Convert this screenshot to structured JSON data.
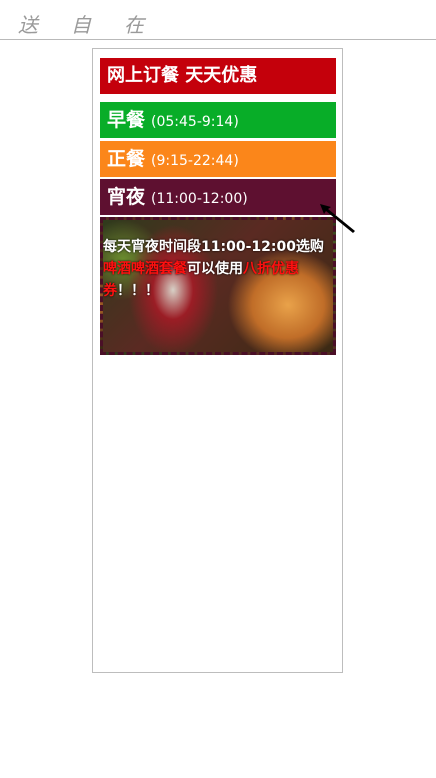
{
  "topbar": {
    "text": "送自在"
  },
  "header": {
    "title": "网上订餐 天天优惠"
  },
  "meals": [
    {
      "name": "早餐",
      "time": "(05:45-9:14)"
    },
    {
      "name": "正餐",
      "time": "(9:15-22:44)"
    },
    {
      "name": "宵夜",
      "time": "(11:00-12:00)"
    }
  ],
  "promo": {
    "part1": "每天宵夜时间段11:00-12:00选购",
    "highlight1": "啤酒啤酒套餐",
    "part2": "可以使用",
    "highlight2": "八折优惠券",
    "part3": "！！！"
  },
  "colors": {
    "header": "#c4000b",
    "breakfast": "#08ad28",
    "dinner": "#fb861a",
    "supper": "#5e1030",
    "highlight": "#ff1010"
  },
  "icons": {
    "cursor": "arrow-cursor-icon"
  }
}
